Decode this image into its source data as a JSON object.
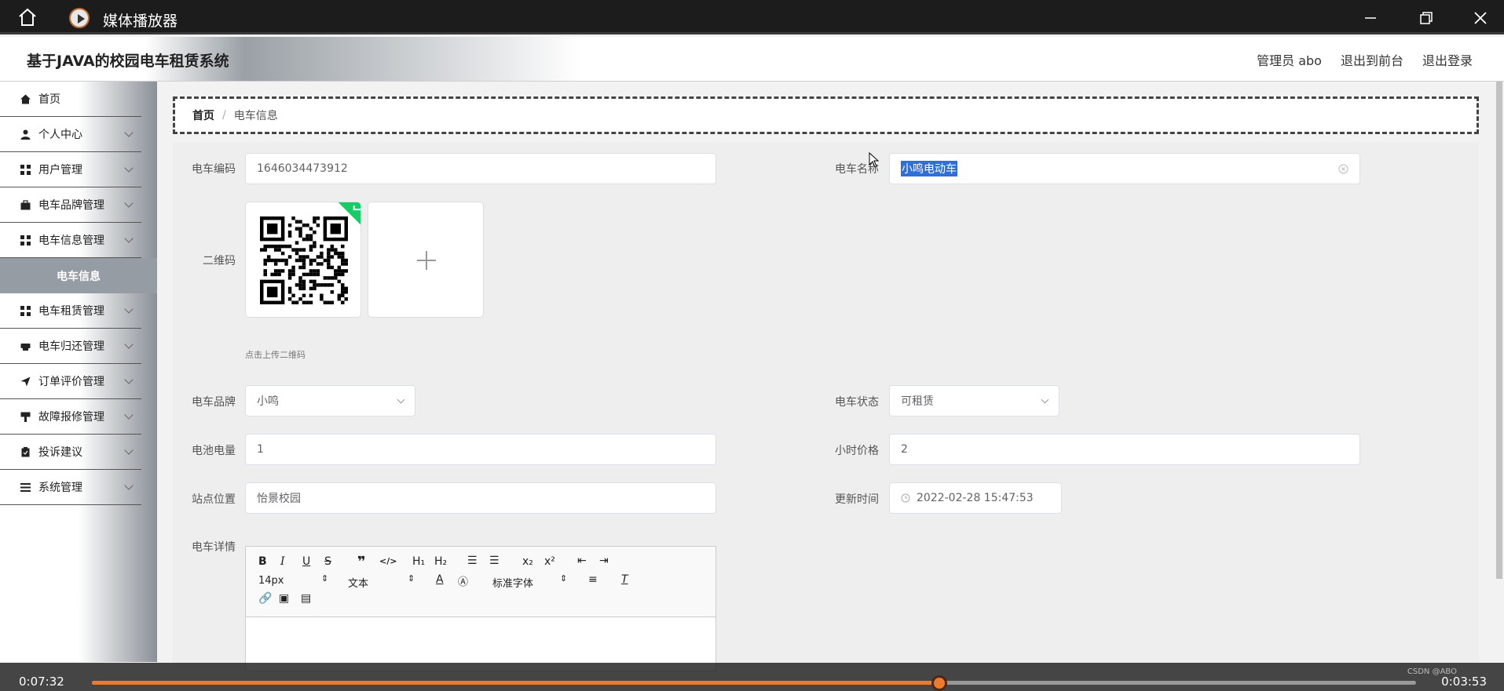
{
  "player": {
    "title": "媒体播放器",
    "time_elapsed": "0:07:32",
    "time_remaining": "0:03:53",
    "progress_fraction": 0.64,
    "watermark": "CSDN @ABO"
  },
  "header": {
    "site_title": "基于JAVA的校园电车租赁系统",
    "admin_label": "管理员 abo",
    "to_frontend": "退出到前台",
    "logout": "退出登录"
  },
  "sidebar": {
    "items": [
      {
        "label": "首页"
      },
      {
        "label": "个人中心"
      },
      {
        "label": "用户管理"
      },
      {
        "label": "电车品牌管理"
      },
      {
        "label": "电车信息管理"
      },
      {
        "label": "电车信息"
      },
      {
        "label": "电车租赁管理"
      },
      {
        "label": "电车归还管理"
      },
      {
        "label": "订单评价管理"
      },
      {
        "label": "故障报修管理"
      },
      {
        "label": "投诉建议"
      },
      {
        "label": "系统管理"
      }
    ]
  },
  "breadcrumb": {
    "home": "首页",
    "sep": "/",
    "current": "电车信息"
  },
  "form": {
    "code_label": "电车编码",
    "code_value": "1646034473912",
    "name_label": "电车名称",
    "name_value": "小鸣电动车",
    "qr_label": "二维码",
    "qr_hint": "点击上传二维码",
    "brand_label": "电车品牌",
    "brand_value": "小鸣",
    "status_label": "电车状态",
    "status_value": "可租赁",
    "battery_label": "电池电量",
    "battery_value": "1",
    "price_label": "小时价格",
    "price_value": "2",
    "site_label": "站点位置",
    "site_value": "怡景校园",
    "update_label": "更新时间",
    "update_value": "2022-02-28 15:47:53",
    "detail_label": "电车详情"
  },
  "editor": {
    "font_size": "14px",
    "block_type": "文本",
    "font_family": "标准字体"
  }
}
